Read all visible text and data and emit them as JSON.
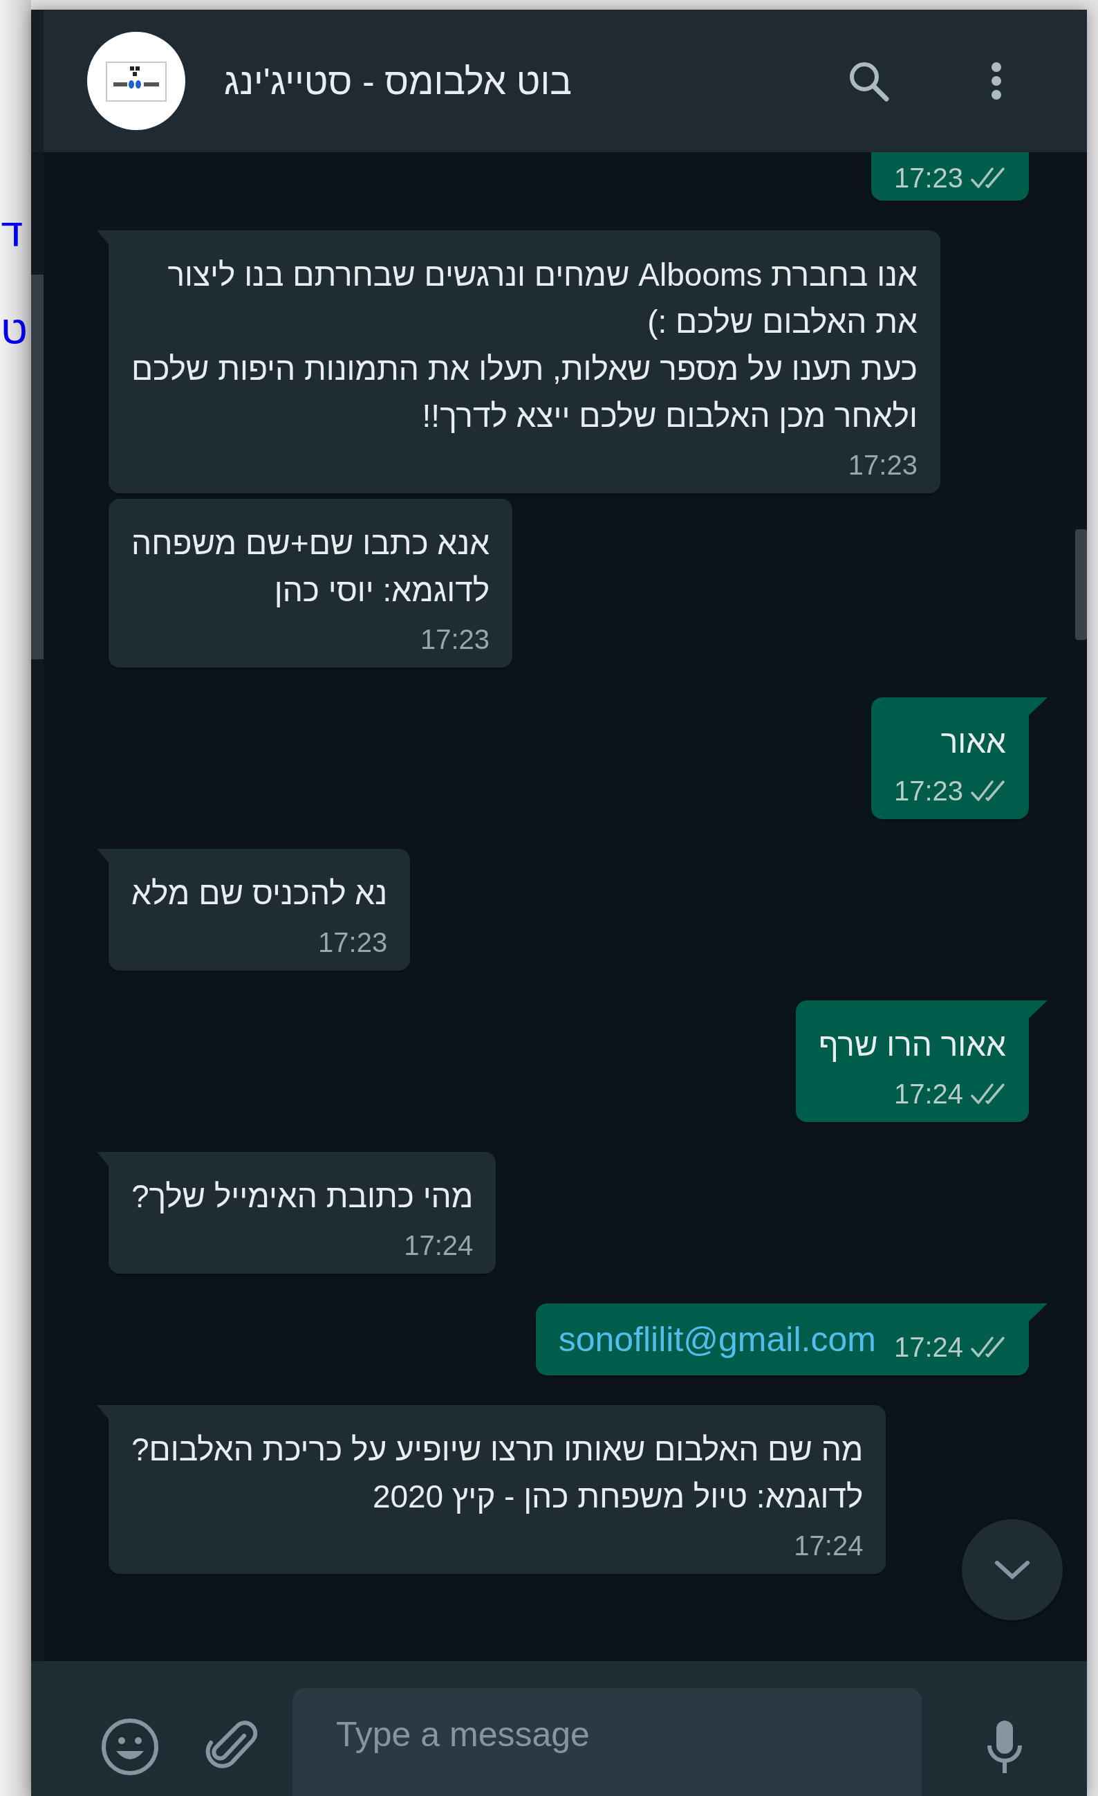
{
  "backdrop_text": [
    "ד",
    "ט"
  ],
  "header": {
    "title": "בוט אלבומס - סטייג'ינג"
  },
  "messages": [
    {
      "kind": "outgoing",
      "cut": true,
      "tail": false,
      "time": "17:23",
      "read": false
    },
    {
      "kind": "incoming",
      "tail": true,
      "lines": [
        "אנו בחברת Albooms שמחים ונרגשים שבחרתם בנו ליצור",
        "את האלבום שלכם :)",
        "כעת תענו על מספר שאלות, תעלו את התמונות היפות שלכם",
        "ולאחר מכן האלבום שלכם ייצא לדרך!!"
      ],
      "time": "17:23"
    },
    {
      "kind": "incoming",
      "tail": false,
      "lines": [
        "אנא כתבו שם+שם משפחה",
        "לדוגמא: יוסי כהן"
      ],
      "time": "17:23"
    },
    {
      "kind": "outgoing",
      "tail": true,
      "lines": [
        "אאור"
      ],
      "time": "17:23",
      "read": false
    },
    {
      "kind": "incoming",
      "tail": true,
      "lines": [
        "נא להכניס שם מלא"
      ],
      "time": "17:23"
    },
    {
      "kind": "outgoing",
      "tail": true,
      "lines": [
        "אאור הרו שרף"
      ],
      "time": "17:24",
      "read": false
    },
    {
      "kind": "incoming",
      "tail": true,
      "lines": [
        "מהי כתובת האימייל שלך?"
      ],
      "time": "17:24"
    },
    {
      "kind": "outgoing_link",
      "tail": true,
      "lines": [
        "sonoflilit@gmail.com"
      ],
      "time": "17:24",
      "read": false
    },
    {
      "kind": "incoming",
      "tail": true,
      "lines": [
        "מה שם האלבום שאותו תרצו שיופיע על כריכת האלבום?",
        "לדוגמא: טיול משפחת כהן - קיץ 2020"
      ],
      "time": "17:24"
    }
  ],
  "composer": {
    "placeholder": "Type a message"
  }
}
